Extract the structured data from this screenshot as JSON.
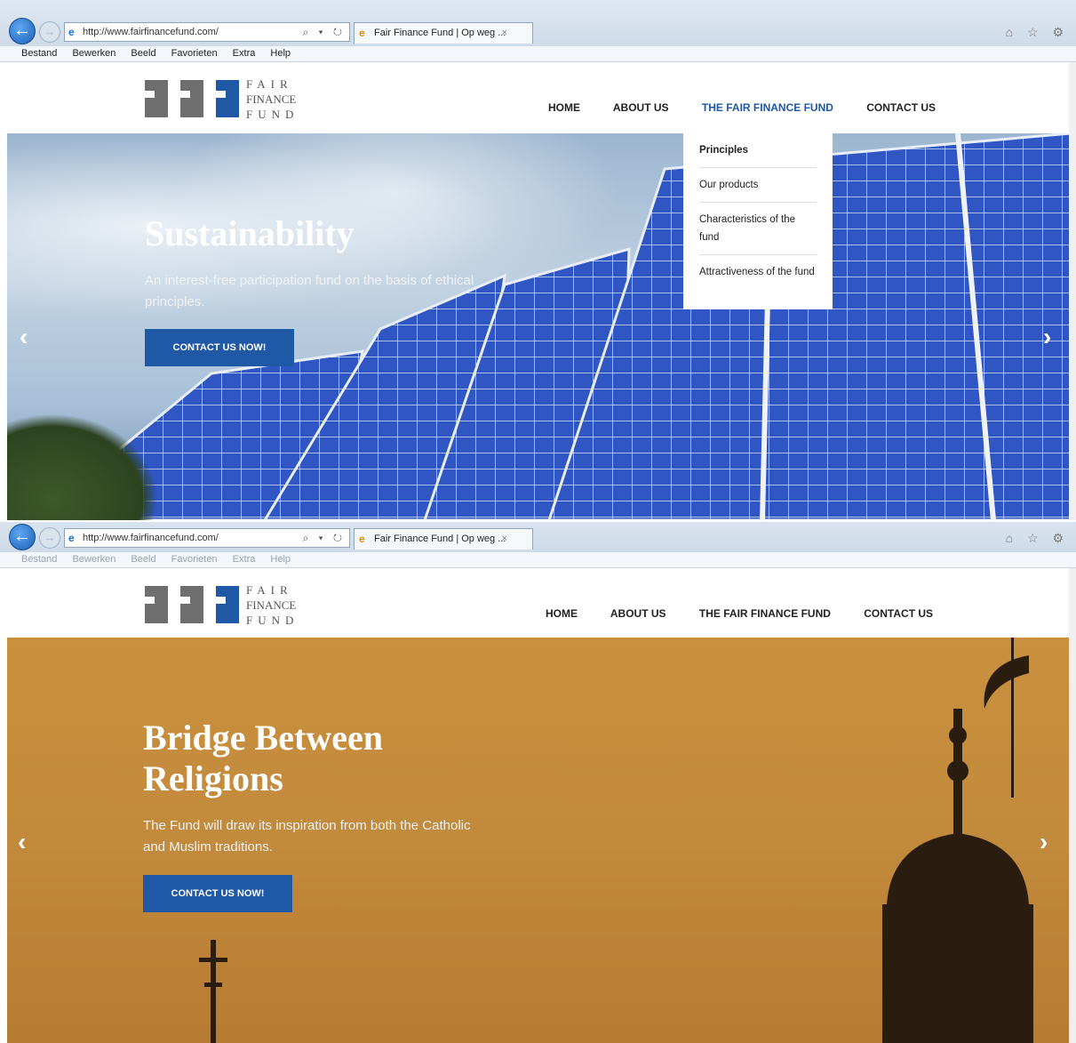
{
  "browser": {
    "url": "http://www.fairfinancefund.com/",
    "tab_title": "Fair Finance Fund | Op weg ...",
    "tab_close": "×",
    "back_glyph": "←",
    "forward_glyph": "→",
    "address_controls": "⌕ ▾ ↻",
    "window_icons": "⌂ ☆ ⚙",
    "menu": [
      "Bestand",
      "Bewerken",
      "Beeld",
      "Favorieten",
      "Extra",
      "Help"
    ]
  },
  "site": {
    "logo_lines": [
      "FAIR",
      "FINANCE",
      "FUND"
    ],
    "nav": [
      "HOME",
      "ABOUT US",
      "THE FAIR FINANCE FUND",
      "CONTACT US"
    ]
  },
  "dropdown": {
    "items": [
      "Principles",
      "Our products",
      "Characteristics of the fund",
      "Attractiveness of the fund"
    ]
  },
  "slide1": {
    "title": "Sustainability",
    "subtitle": "An interest-free participation fund on the basis of ethical principles.",
    "cta": "CONTACT US NOW!",
    "prev": "‹",
    "next": "›"
  },
  "slide2": {
    "title": "Bridge Between Religions",
    "subtitle": "The Fund will draw its inspiration from both the Catholic and Muslim traditions.",
    "cta": "CONTACT US NOW!",
    "prev": "‹",
    "next": "›"
  },
  "colors": {
    "brand_blue": "#1f58a4",
    "logo_gray": "#6e6e6e",
    "mosque_sky": "#c28a3c"
  }
}
